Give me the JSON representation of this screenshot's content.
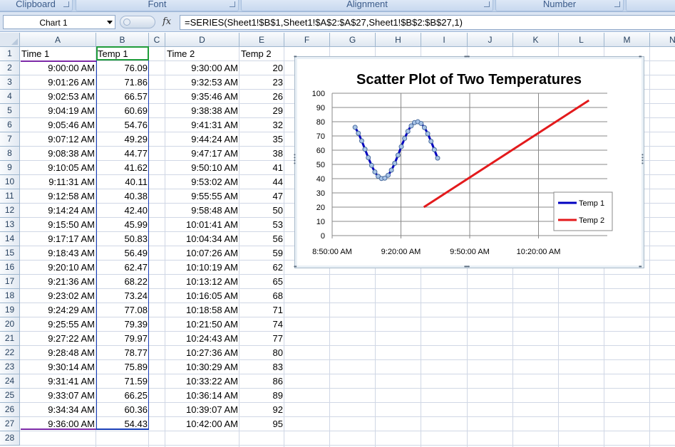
{
  "ribbon": {
    "groups": [
      {
        "label": "Clipboard"
      },
      {
        "label": "Font"
      },
      {
        "label": "Alignment"
      },
      {
        "label": "Number"
      }
    ]
  },
  "formula_bar": {
    "name_box": "Chart 1",
    "fx": "fx",
    "formula": "=SERIES(Sheet1!$B$1,Sheet1!$A$2:$A$27,Sheet1!$B$2:$B$27,1)"
  },
  "columns": [
    "A",
    "B",
    "C",
    "D",
    "E",
    "F",
    "G",
    "H",
    "I",
    "J",
    "K",
    "L",
    "M",
    "N"
  ],
  "rows": [
    "1",
    "2",
    "3",
    "4",
    "5",
    "6",
    "7",
    "8",
    "9",
    "10",
    "11",
    "12",
    "13",
    "14",
    "15",
    "16",
    "17",
    "18",
    "19",
    "20",
    "21",
    "22",
    "23",
    "24",
    "25",
    "26",
    "27",
    "28"
  ],
  "headers": {
    "time1": "Time 1",
    "temp1": "Temp 1",
    "time2": "Time 2",
    "temp2": "Temp 2"
  },
  "table": [
    [
      "9:00:00 AM",
      "76.09",
      "9:30:00 AM",
      "20"
    ],
    [
      "9:01:26 AM",
      "71.86",
      "9:32:53 AM",
      "23"
    ],
    [
      "9:02:53 AM",
      "66.57",
      "9:35:46 AM",
      "26"
    ],
    [
      "9:04:19 AM",
      "60.69",
      "9:38:38 AM",
      "29"
    ],
    [
      "9:05:46 AM",
      "54.76",
      "9:41:31 AM",
      "32"
    ],
    [
      "9:07:12 AM",
      "49.29",
      "9:44:24 AM",
      "35"
    ],
    [
      "9:08:38 AM",
      "44.77",
      "9:47:17 AM",
      "38"
    ],
    [
      "9:10:05 AM",
      "41.62",
      "9:50:10 AM",
      "41"
    ],
    [
      "9:11:31 AM",
      "40.11",
      "9:53:02 AM",
      "44"
    ],
    [
      "9:12:58 AM",
      "40.38",
      "9:55:55 AM",
      "47"
    ],
    [
      "9:14:24 AM",
      "42.40",
      "9:58:48 AM",
      "50"
    ],
    [
      "9:15:50 AM",
      "45.99",
      "10:01:41 AM",
      "53"
    ],
    [
      "9:17:17 AM",
      "50.83",
      "10:04:34 AM",
      "56"
    ],
    [
      "9:18:43 AM",
      "56.49",
      "10:07:26 AM",
      "59"
    ],
    [
      "9:20:10 AM",
      "62.47",
      "10:10:19 AM",
      "62"
    ],
    [
      "9:21:36 AM",
      "68.22",
      "10:13:12 AM",
      "65"
    ],
    [
      "9:23:02 AM",
      "73.24",
      "10:16:05 AM",
      "68"
    ],
    [
      "9:24:29 AM",
      "77.08",
      "10:18:58 AM",
      "71"
    ],
    [
      "9:25:55 AM",
      "79.39",
      "10:21:50 AM",
      "74"
    ],
    [
      "9:27:22 AM",
      "79.97",
      "10:24:43 AM",
      "77"
    ],
    [
      "9:28:48 AM",
      "78.77",
      "10:27:36 AM",
      "80"
    ],
    [
      "9:30:14 AM",
      "75.89",
      "10:30:29 AM",
      "83"
    ],
    [
      "9:31:41 AM",
      "71.59",
      "10:33:22 AM",
      "86"
    ],
    [
      "9:33:07 AM",
      "66.25",
      "10:36:14 AM",
      "89"
    ],
    [
      "9:34:34 AM",
      "60.36",
      "10:39:07 AM",
      "92"
    ],
    [
      "9:36:00 AM",
      "54.43",
      "10:42:00 AM",
      "95"
    ]
  ],
  "colors": {
    "temp1": "#0000c0",
    "temp2": "#e31a1c",
    "selection_temp1": "#1a3fb8",
    "selection_time1": "#7d2aa8",
    "selection_header": "#1f9c3a"
  },
  "chart_data": {
    "type": "scatter",
    "title": "Scatter Plot of Two Temperatures",
    "xlabel": "",
    "ylabel": "",
    "ylim": [
      0,
      100
    ],
    "yticks": [
      "0",
      "10",
      "20",
      "30",
      "40",
      "50",
      "60",
      "70",
      "80",
      "90",
      "100"
    ],
    "xlim": [
      "8:50:00 AM",
      "10:50:00 AM"
    ],
    "xticks": [
      "8:50:00 AM",
      "9:20:00 AM",
      "9:50:00 AM",
      "10:20:00 AM"
    ],
    "grid": true,
    "legend": "right",
    "series": [
      {
        "name": "Temp 1",
        "style": "smoothed line, selected",
        "x": [
          "9:00:00 AM",
          "9:01:26 AM",
          "9:02:53 AM",
          "9:04:19 AM",
          "9:05:46 AM",
          "9:07:12 AM",
          "9:08:38 AM",
          "9:10:05 AM",
          "9:11:31 AM",
          "9:12:58 AM",
          "9:14:24 AM",
          "9:15:50 AM",
          "9:17:17 AM",
          "9:18:43 AM",
          "9:20:10 AM",
          "9:21:36 AM",
          "9:23:02 AM",
          "9:24:29 AM",
          "9:25:55 AM",
          "9:27:22 AM",
          "9:28:48 AM",
          "9:30:14 AM",
          "9:31:41 AM",
          "9:33:07 AM",
          "9:34:34 AM",
          "9:36:00 AM"
        ],
        "y": [
          76.09,
          71.86,
          66.57,
          60.69,
          54.76,
          49.29,
          44.77,
          41.62,
          40.11,
          40.38,
          42.4,
          45.99,
          50.83,
          56.49,
          62.47,
          68.22,
          73.24,
          77.08,
          79.39,
          79.97,
          78.77,
          75.89,
          71.59,
          66.25,
          60.36,
          54.43
        ]
      },
      {
        "name": "Temp 2",
        "style": "line",
        "x": [
          "9:30:00 AM",
          "9:32:53 AM",
          "9:35:46 AM",
          "9:38:38 AM",
          "9:41:31 AM",
          "9:44:24 AM",
          "9:47:17 AM",
          "9:50:10 AM",
          "9:53:02 AM",
          "9:55:55 AM",
          "9:58:48 AM",
          "10:01:41 AM",
          "10:04:34 AM",
          "10:07:26 AM",
          "10:10:19 AM",
          "10:13:12 AM",
          "10:16:05 AM",
          "10:18:58 AM",
          "10:21:50 AM",
          "10:24:43 AM",
          "10:27:36 AM",
          "10:30:29 AM",
          "10:33:22 AM",
          "10:36:14 AM",
          "10:39:07 AM",
          "10:42:00 AM"
        ],
        "y": [
          20,
          23,
          26,
          29,
          32,
          35,
          38,
          41,
          44,
          47,
          50,
          53,
          56,
          59,
          62,
          65,
          68,
          71,
          74,
          77,
          80,
          83,
          86,
          89,
          92,
          95
        ]
      }
    ]
  }
}
